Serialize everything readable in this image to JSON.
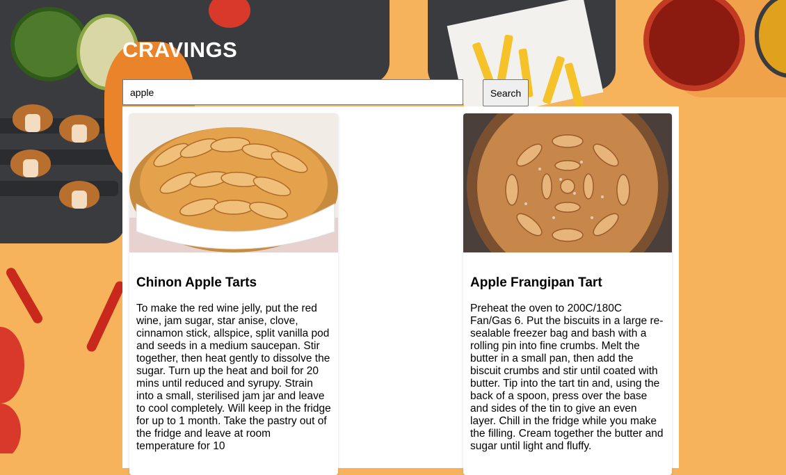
{
  "app": {
    "title": "CRAVINGS"
  },
  "search": {
    "value": "apple",
    "button_label": "Search"
  },
  "results": [
    {
      "title": "Chinon Apple Tarts",
      "description": "To make the red wine jelly, put the red wine, jam sugar, star anise, clove, cinnamon stick, allspice, split vanilla pod and seeds in a medium saucepan. Stir together, then heat gently to dissolve the sugar. Turn up the heat and boil for 20 mins until reduced and syrupy. Strain into a small, sterilised jam jar and leave to cool completely. Will keep in the fridge for up to 1 month. Take the pastry out of the fridge and leave at room temperature for 10"
    },
    {
      "title": "Apple Frangipan Tart",
      "description": "Preheat the oven to 200C/180C Fan/Gas 6. Put the biscuits in a large re-sealable freezer bag and bash with a rolling pin into fine crumbs. Melt the butter in a small pan, then add the biscuit crumbs and stir until coated with butter. Tip into the tart tin and, using the back of a spoon, press over the base and sides of the tin to give an even layer. Chill in the fridge while you make the filling. Cream together the butter and sugar until light and fluffy."
    }
  ],
  "colors": {
    "background": "#f7b35c",
    "grill": "#3a3b3f",
    "title": "#ffffff"
  }
}
